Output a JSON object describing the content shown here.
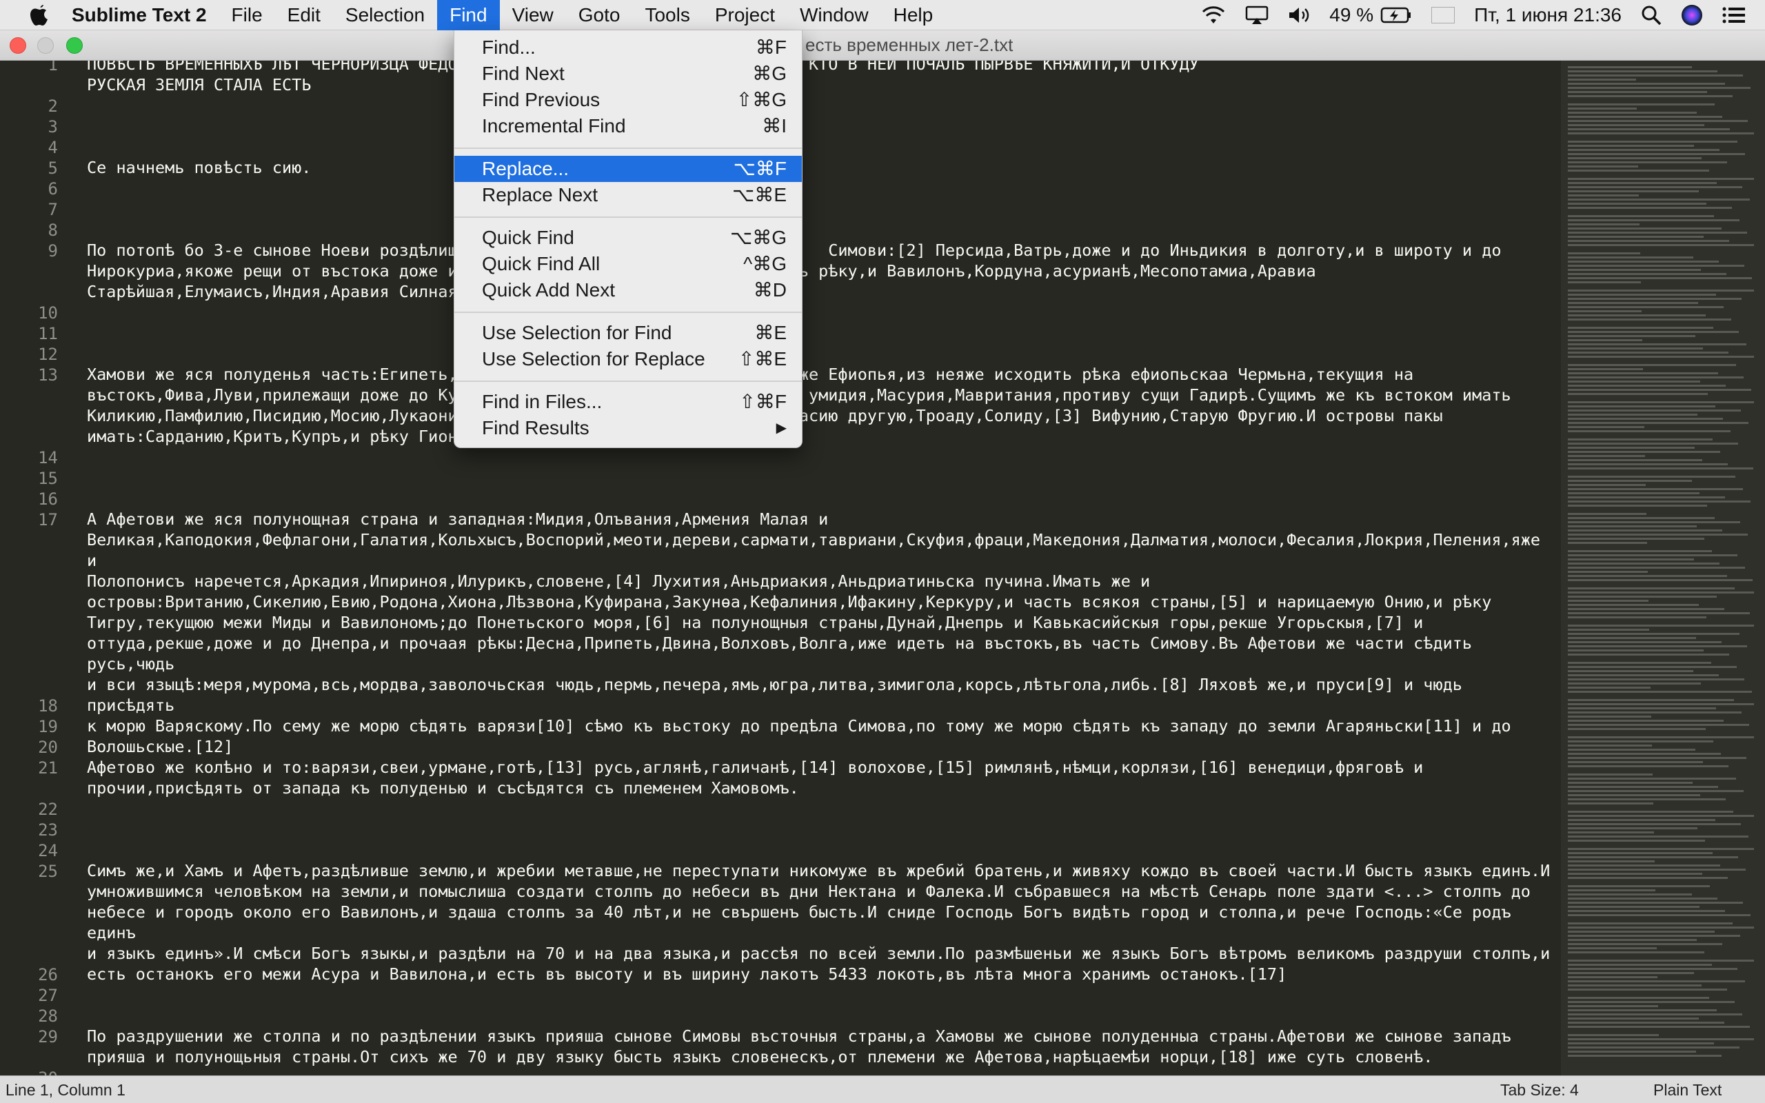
{
  "menubar": {
    "app_name": "Sublime Text 2",
    "menus": [
      "File",
      "Edit",
      "Selection",
      "Find",
      "View",
      "Goto",
      "Tools",
      "Project",
      "Window",
      "Help"
    ],
    "active_menu": "Find",
    "battery": "49 %",
    "datetime": "Пт, 1 июня  21:36"
  },
  "window": {
    "title": "есть временных лет-2.txt"
  },
  "find_menu": {
    "items": [
      {
        "label": "Find...",
        "shortcut": "⌘F"
      },
      {
        "label": "Find Next",
        "shortcut": "⌘G"
      },
      {
        "label": "Find Previous",
        "shortcut": "⇧⌘G"
      },
      {
        "label": "Incremental Find",
        "shortcut": "⌘I"
      },
      {
        "label": "Replace...",
        "shortcut": "⌥⌘F"
      },
      {
        "label": "Replace Next",
        "shortcut": "⌥⌘E"
      },
      {
        "label": "Quick Find",
        "shortcut": "⌥⌘G"
      },
      {
        "label": "Quick Find All",
        "shortcut": "^⌘G"
      },
      {
        "label": "Quick Add Next",
        "shortcut": "⌘D"
      },
      {
        "label": "Use Selection for Find",
        "shortcut": "⌘E"
      },
      {
        "label": "Use Selection for Replace",
        "shortcut": "⇧⌘E"
      },
      {
        "label": "Find in Files...",
        "shortcut": "⇧⌘F"
      },
      {
        "label": "Find Results",
        "shortcut": "▶"
      }
    ]
  },
  "editor": {
    "lines": [
      {
        "num": "1",
        "text": "ПОВѢСТЬ ВРЕМЕННЫХЪ ЛѢТ ЧЕРНОРИЗЦА ФЕДО... ЕСТЬ ПОШЛА РУСКАЯ ЗЕМЛЯ <...> И КТО В НЕИ ПОЧАЛЬ ПЫРВѢЕ КНЯЖИТИ,И ОТКУДУ\nРУСКАЯ ЗЕМЛЯ СТАЛА ЕСТЬ"
      },
      {
        "num": "2",
        "text": ""
      },
      {
        "num": "3",
        "text": ""
      },
      {
        "num": "4",
        "text": ""
      },
      {
        "num": "5",
        "text": "Се начнемь повѣсть сию."
      },
      {
        "num": "6",
        "text": ""
      },
      {
        "num": "7",
        "text": ""
      },
      {
        "num": "8",
        "text": ""
      },
      {
        "num": "9",
        "text": "По потопѣ бо 3-е сынове Ноеви роздѣлиш                                      Симови:[2] Персида,Ватрь,доже и до Иньдикия в долготу,и в широту и до\nНирокуриа,якоже рещи от въстока доже и                                  ть рѣку,и Вавилонъ,Кордуна,асурианѣ,Месопотамиа,Аравиа\nСтарѣйшая,Елумаисъ,Индия,Аравия Силная"
      },
      {
        "num": "10",
        "text": ""
      },
      {
        "num": "11",
        "text": ""
      },
      {
        "num": "12",
        "text": ""
      },
      {
        "num": "13",
        "text": "Хамови же яся полуденья часть:Египеть,                                   же Ефиопья,из неяже исходить рѣка ефиопьскаа Чермьна,текущия на\nвъстокъ,Фива,Луви,прилежащи доже до Ку                                    умидия,Масурия,Мавритания,противу сущи Гадирѣ.Сущимъ же къ встоком имать\nКиликию,Памфилию,Писидию,Мосию,Лукаони                                   асию другую,Троаду,Солиду,[3] Вифунию,Старую Фругию.И островы пакы\nимать:Сарданию,Критъ,Купръ,и рѣку Гион"
      },
      {
        "num": "14",
        "text": ""
      },
      {
        "num": "15",
        "text": ""
      },
      {
        "num": "16",
        "text": ""
      },
      {
        "num": "17",
        "text": "А Афетови же яся полунощная страна и западная:Мидия,Олъвания,Армения Малая и\nВеликая,Каподокия,Фефлагони,Галатия,Кольхысъ,Воспорий,меоти,дереви,сармати,тавриани,Скуфия,фраци,Македония,Далматия,молоси,Фесалия,Локрия,Пеления,яже и\nПолопонисъ наречется,Аркадия,Ипириноя,Илурикъ,словене,[4] Лухития,Аньдриакия,Аньдриатиньска пучина.Имать же и\nостровы:Вританию,Сикелию,Евию,Родона,Хиона,Лѣзвона,Куфирана,Закунѳа,Кефалиния,Ифакину,Керкуру,и часть всякоя страны,[5] и нарицаемую Онию,и рѣку\nТигру,текущюю межи Миды и Вавилономъ;до Понетьского моря,[6] на полунощныя страны,Дунай,Днепрь и Кавькасийскыя горы,рекше Угорьскыя,[7] и\nоттуда,рекше,доже и до Днепра,и прочаая рѣкы:Десна,Припеть,Двина,Волховъ,Волга,иже идеть на въстокъ,въ часть Симову.Въ Афетови же части сѣдить русь,чюдь\nи вси языцѣ:меря,мурома,всь,мордва,заволочьская чюдь,пермь,печера,ямь,югра,литва,зимигола,корсь,лѣтьгола,либь.[8] Ляховѣ же,и пруси[9] и чюдь присѣдять\nк морю Варяскому.По сему же морю сѣдять варязи[10] сѣмо къ вьстоку до предѣла Симова,по тому же морю сѣдять къ западу до земли Агаряньски[11] и до\nВолошьскые.[12]"
      },
      {
        "num": "18",
        "text": ""
      },
      {
        "num": "19",
        "text": ""
      },
      {
        "num": "20",
        "text": ""
      },
      {
        "num": "21",
        "text": "Афетово же колѣно и то:варязи,свеи,урмане,готѣ,[13] русь,аглянѣ,галичанѣ,[14] волохове,[15] римлянѣ,нѣмци,корлязи,[16] венедици,фряговѣ и\nпрочии,присѣдять от запада къ полуденью и съсѣдятся съ племенем Хамовомъ."
      },
      {
        "num": "22",
        "text": ""
      },
      {
        "num": "23",
        "text": ""
      },
      {
        "num": "24",
        "text": ""
      },
      {
        "num": "25",
        "text": "Симъ же,и Хамъ и Афетъ,раздѣливше землю,и жребии метавше,не переступати никомуже въ жребий братень,и живяху кождо въ своей части.И бысть языкъ единъ.И\nумножившимся человѣком на земли,и помыслиша создати столпъ до небеси въ дни Нектана и Фалека.И събравшеся на мѣстѣ Сенарь поле здати <...> столпъ до\nнебесе и городъ около его Вавилонъ,и здаша столпъ за 40 лѣт,и не свършенъ бысть.И сниде Господь Богъ видѣть город и столпа,и рече Господь:«Се родъ единъ\nи языкъ единъ».И смѣси Богъ языкы,и раздѣли на 70 и на два языка,и рассѣя по всей земли.По размѣшеньи же языкъ Богъ вѣтромъ великомъ раздруши столпъ,и\nесть останокъ его межи Асура и Вавилона,и есть въ высоту и въ ширину лакотъ 5433 локоть,въ лѣта многа хранимъ останокъ.[17]"
      },
      {
        "num": "26",
        "text": ""
      },
      {
        "num": "27",
        "text": ""
      },
      {
        "num": "28",
        "text": ""
      },
      {
        "num": "29",
        "text": "По раздрушении же столпа и по раздѣлении языкъ прияша сынове Симовы въсточныя страны,а Хамовы же сынове полуденныа страны.Афетови же сынове западъ\nприяша и полунощьныя страны.От сихъ же 70 и дву языку бысть языкъ словенескъ,от племени же Афетова,нарѣцаемѣи норци,[18] иже суть словенѣ."
      },
      {
        "num": "30",
        "text": ""
      }
    ]
  },
  "statusbar": {
    "position": "Line 1, Column 1",
    "tab_size": "Tab Size: 4",
    "syntax": "Plain Text"
  }
}
